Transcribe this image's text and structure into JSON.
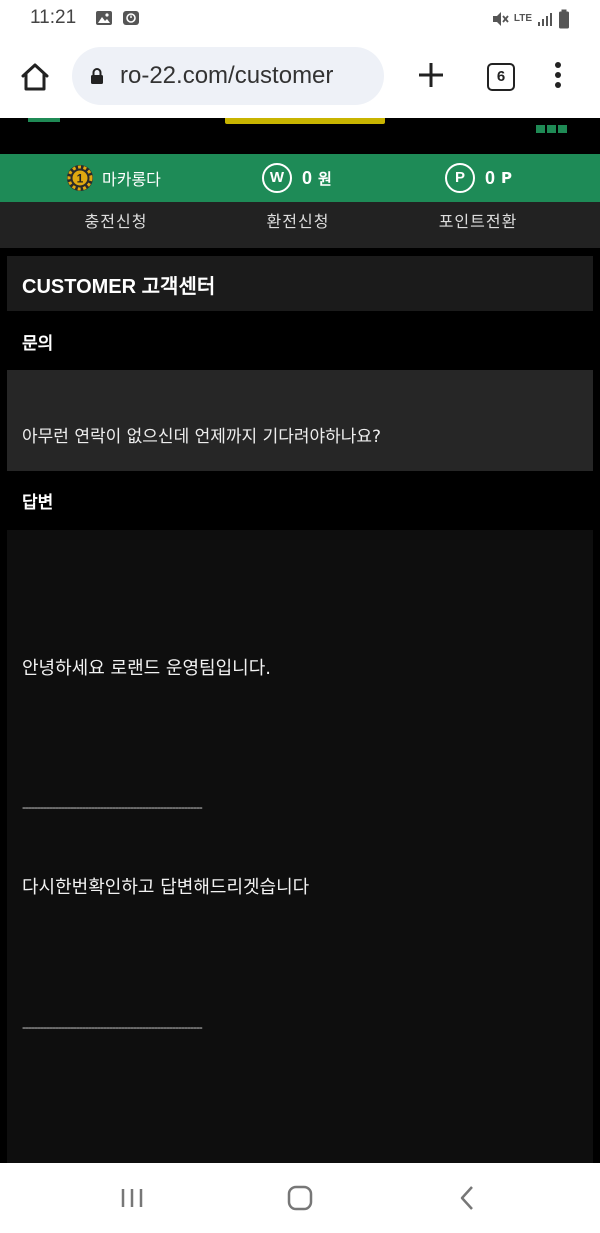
{
  "status_bar": {
    "time": "11:21",
    "left_icons": [
      "image-icon",
      "clock-icon"
    ],
    "right_icons": [
      "mute-icon",
      "lte-icon",
      "signal-icon",
      "battery-icon"
    ],
    "lte_label": "LTE"
  },
  "browser": {
    "url": "ro-22.com/customer",
    "tab_count": "6"
  },
  "info_bar": {
    "username": "마카롱다",
    "money_icon_label": "W",
    "money_value": "0",
    "money_unit": "원",
    "point_icon_label": "P",
    "point_value": "0",
    "point_unit": "P"
  },
  "actions": {
    "deposit": "충전신청",
    "withdraw": "환전신청",
    "point_convert": "포인트전환"
  },
  "page": {
    "title": "CUSTOMER 고객센터",
    "inquiry_label": "문의",
    "inquiry_text": "아무런 연락이 없으신데 언제까지 기다려야하나요?",
    "answer_label": "답변",
    "answer_lines": [
      "안녕하세요 로랜드 운영팀입니다.",
      "------------------------------------------------------------",
      "다시한번확인하고 답변해드리겟습니다",
      "------------------------------------------------------------"
    ]
  },
  "colors": {
    "brand_green": "#1e8b57",
    "logo_yellow": "#c8b400"
  }
}
